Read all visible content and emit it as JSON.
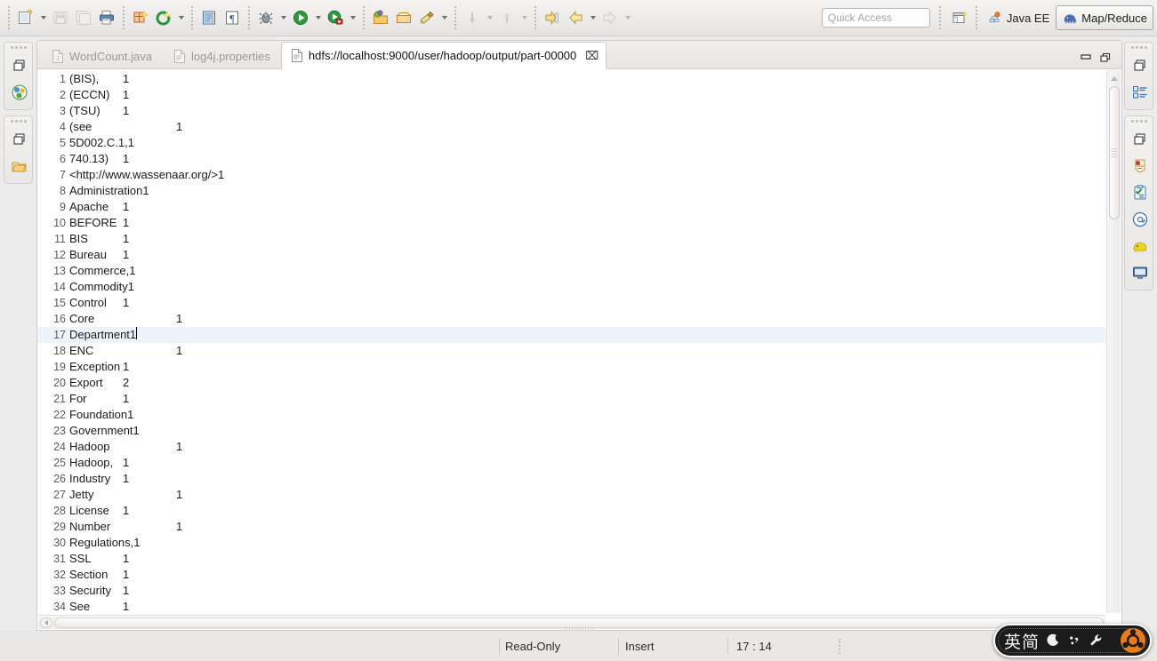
{
  "toolbar": {
    "items": [
      {
        "name": "new-button",
        "icon": "new-file-icon",
        "dropdown": true,
        "enabled": true
      },
      {
        "name": "save-button",
        "icon": "save-icon",
        "dropdown": false,
        "enabled": false
      },
      {
        "name": "save-all-button",
        "icon": "save-all-icon",
        "dropdown": false,
        "enabled": false
      },
      {
        "name": "print-button",
        "icon": "print-icon",
        "dropdown": false,
        "enabled": true
      },
      {
        "name": "new-wizard-button",
        "icon": "new-wizard-icon",
        "dropdown": false,
        "enabled": true
      },
      {
        "name": "refresh-button",
        "icon": "refresh-icon",
        "dropdown": true,
        "enabled": true
      },
      {
        "name": "open-type-button",
        "icon": "open-type-icon",
        "dropdown": false,
        "enabled": true
      },
      {
        "name": "toggle-markers-button",
        "icon": "paragraph-icon",
        "dropdown": false,
        "enabled": true
      },
      {
        "name": "debug-button",
        "icon": "debug-bug-icon",
        "dropdown": true,
        "enabled": true
      },
      {
        "name": "run-button",
        "icon": "run-play-icon",
        "dropdown": true,
        "enabled": true
      },
      {
        "name": "coverage-button",
        "icon": "coverage-icon",
        "dropdown": true,
        "enabled": true
      },
      {
        "name": "new-java-project-button",
        "icon": "java-project-icon",
        "dropdown": false,
        "enabled": true
      },
      {
        "name": "new-package-button",
        "icon": "package-icon",
        "dropdown": false,
        "enabled": true
      },
      {
        "name": "new-class-button",
        "icon": "new-class-icon",
        "dropdown": true,
        "enabled": true
      },
      {
        "name": "next-annotation-button",
        "icon": "next-annotation-icon",
        "dropdown": true,
        "enabled": false
      },
      {
        "name": "previous-annotation-button",
        "icon": "previous-annotation-icon",
        "dropdown": true,
        "enabled": false
      },
      {
        "name": "last-edit-location-button",
        "icon": "last-edit-location-icon",
        "dropdown": false,
        "enabled": true
      },
      {
        "name": "back-button",
        "icon": "back-arrow-icon",
        "dropdown": true,
        "enabled": true
      },
      {
        "name": "forward-button",
        "icon": "forward-arrow-icon",
        "dropdown": true,
        "enabled": false
      }
    ],
    "quick_access_placeholder": "Quick Access",
    "open_perspective_label": "open-perspective",
    "perspectives": [
      {
        "label": "Java EE",
        "icon": "java-ee-icon",
        "active": false
      },
      {
        "label": "Map/Reduce",
        "icon": "elephant-icon",
        "active": true
      }
    ]
  },
  "left_sidebar": {
    "groups": [
      {
        "items": [
          {
            "name": "restore-view-button",
            "icon": "restore-icon",
            "label": "Restore"
          },
          {
            "name": "dfs-locations-view-button",
            "icon": "dfs-locations-icon",
            "label": "DFS Locations"
          }
        ]
      },
      {
        "items": [
          {
            "name": "restore-view-button",
            "icon": "restore-icon",
            "label": "Restore"
          },
          {
            "name": "project-explorer-view-button",
            "icon": "project-explorer-icon",
            "label": "Project Explorer"
          }
        ]
      }
    ]
  },
  "right_sidebar": {
    "groups": [
      {
        "items": [
          {
            "name": "restore-view-button",
            "icon": "restore-icon",
            "label": "Restore"
          },
          {
            "name": "outline-view-button",
            "icon": "outline-icon",
            "label": "Outline"
          }
        ]
      },
      {
        "items": [
          {
            "name": "restore-view-button",
            "icon": "restore-icon",
            "label": "Restore"
          },
          {
            "name": "problems-view-button",
            "icon": "problems-icon",
            "label": "Problems"
          },
          {
            "name": "tasks-view-button",
            "icon": "tasks-icon",
            "label": "Tasks"
          },
          {
            "name": "javadoc-view-button",
            "icon": "javadoc-at-icon",
            "label": "Javadoc"
          },
          {
            "name": "map-reduce-locations-view-button",
            "icon": "elephant-icon",
            "label": "Map/Reduce Locations"
          },
          {
            "name": "console-view-button",
            "icon": "console-icon",
            "label": "Console"
          }
        ]
      }
    ]
  },
  "editor": {
    "tabs": [
      {
        "label": "WordCount.java",
        "icon": "java-file-icon",
        "active": false,
        "closable": false
      },
      {
        "label": "log4j.properties",
        "icon": "properties-file-icon",
        "active": false,
        "closable": false
      },
      {
        "label": "hdfs://localhost:9000/user/hadoop/output/part-00000",
        "icon": "text-file-icon",
        "active": true,
        "closable": true,
        "close_glyph": "⌧"
      }
    ],
    "controls": [
      {
        "name": "minimize-editor-button",
        "icon": "minimize-icon"
      },
      {
        "name": "maximize-editor-button",
        "icon": "maximize-icon"
      }
    ],
    "highlighted_line": 17,
    "lines": [
      {
        "n": 1,
        "text": "(BIS),\t1"
      },
      {
        "n": 2,
        "text": "(ECCN)\t1"
      },
      {
        "n": 3,
        "text": "(TSU)\t1"
      },
      {
        "n": 4,
        "text": "(see\t\t1"
      },
      {
        "n": 5,
        "text": "5D002.C.1,\t1"
      },
      {
        "n": 6,
        "text": "740.13)\t1"
      },
      {
        "n": 7,
        "text": "<http://www.wassenaar.org/>\t1"
      },
      {
        "n": 8,
        "text": "Administration\t1"
      },
      {
        "n": 9,
        "text": "Apache\t1"
      },
      {
        "n": 10,
        "text": "BEFORE\t1"
      },
      {
        "n": 11,
        "text": "BIS\t1"
      },
      {
        "n": 12,
        "text": "Bureau\t1"
      },
      {
        "n": 13,
        "text": "Commerce,\t1"
      },
      {
        "n": 14,
        "text": "Commodity\t1"
      },
      {
        "n": 15,
        "text": "Control\t1"
      },
      {
        "n": 16,
        "text": "Core\t\t1"
      },
      {
        "n": 17,
        "text": "Department\t1"
      },
      {
        "n": 18,
        "text": "ENC\t\t1"
      },
      {
        "n": 19,
        "text": "Exception\t1"
      },
      {
        "n": 20,
        "text": "Export\t2"
      },
      {
        "n": 21,
        "text": "For\t1"
      },
      {
        "n": 22,
        "text": "Foundation\t1"
      },
      {
        "n": 23,
        "text": "Government\t1"
      },
      {
        "n": 24,
        "text": "Hadoop\t\t1"
      },
      {
        "n": 25,
        "text": "Hadoop,\t1"
      },
      {
        "n": 26,
        "text": "Industry\t1"
      },
      {
        "n": 27,
        "text": "Jetty\t\t1"
      },
      {
        "n": 28,
        "text": "License\t1"
      },
      {
        "n": 29,
        "text": "Number\t\t1"
      },
      {
        "n": 30,
        "text": "Regulations,\t1"
      },
      {
        "n": 31,
        "text": "SSL\t1"
      },
      {
        "n": 32,
        "text": "Section\t1"
      },
      {
        "n": 33,
        "text": "Security\t1"
      },
      {
        "n": 34,
        "text": "See\t1"
      }
    ]
  },
  "statusbar": {
    "read_only": "Read-Only",
    "insert_mode": "Insert",
    "cursor_position": "17 : 14"
  },
  "ime": {
    "mode_label": "英简",
    "icons": [
      {
        "name": "moon-icon"
      },
      {
        "name": "punctuation-icon"
      },
      {
        "name": "wrench-icon"
      },
      {
        "name": "sogou-logo-icon"
      }
    ]
  },
  "colors": {
    "toolbar_bg": "#edecec",
    "editor_bg": "#ffffff",
    "highlight_line": "#ecf3fb",
    "accent_green": "#2d9b3e",
    "accent_orange": "#e8792a",
    "accent_blue": "#3a6ea5"
  }
}
